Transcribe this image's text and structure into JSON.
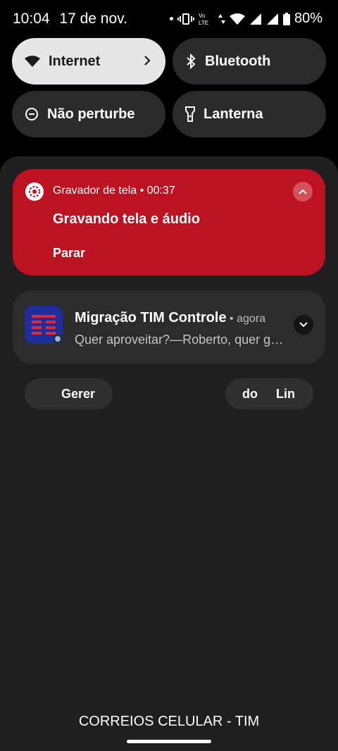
{
  "status_bar": {
    "time": "10:04",
    "date": "17 de nov.",
    "battery": "80%",
    "icons": [
      "dot-icon",
      "vibrate-icon",
      "volte-icon",
      "data-arrows-icon",
      "wifi-icon",
      "signal-icon",
      "signal-icon",
      "battery-icon"
    ]
  },
  "quick_tiles": {
    "internet": "Internet",
    "bluetooth": "Bluetooth",
    "dnd": "Não perturbe",
    "flashlight": "Lanterna"
  },
  "recording_notification": {
    "app": "Gravador de tela • 00:37",
    "title": "Gravando tela e áudio",
    "action": "Parar",
    "color": "#bd1221"
  },
  "tim_notification": {
    "title": "Migração TIM Controle",
    "time": " • agora",
    "body": "Quer aproveitar?—Roberto, quer garantir"
  },
  "actions": {
    "left": "Gerer",
    "right_a": "do",
    "right_b": "Lin"
  },
  "carrier": "CORREIOS CELULAR - TIM",
  "colors": {
    "accent_red": "#bd1221",
    "app_icon_blue": "#1e2f9c",
    "tile_active": "#e6e6e8"
  }
}
